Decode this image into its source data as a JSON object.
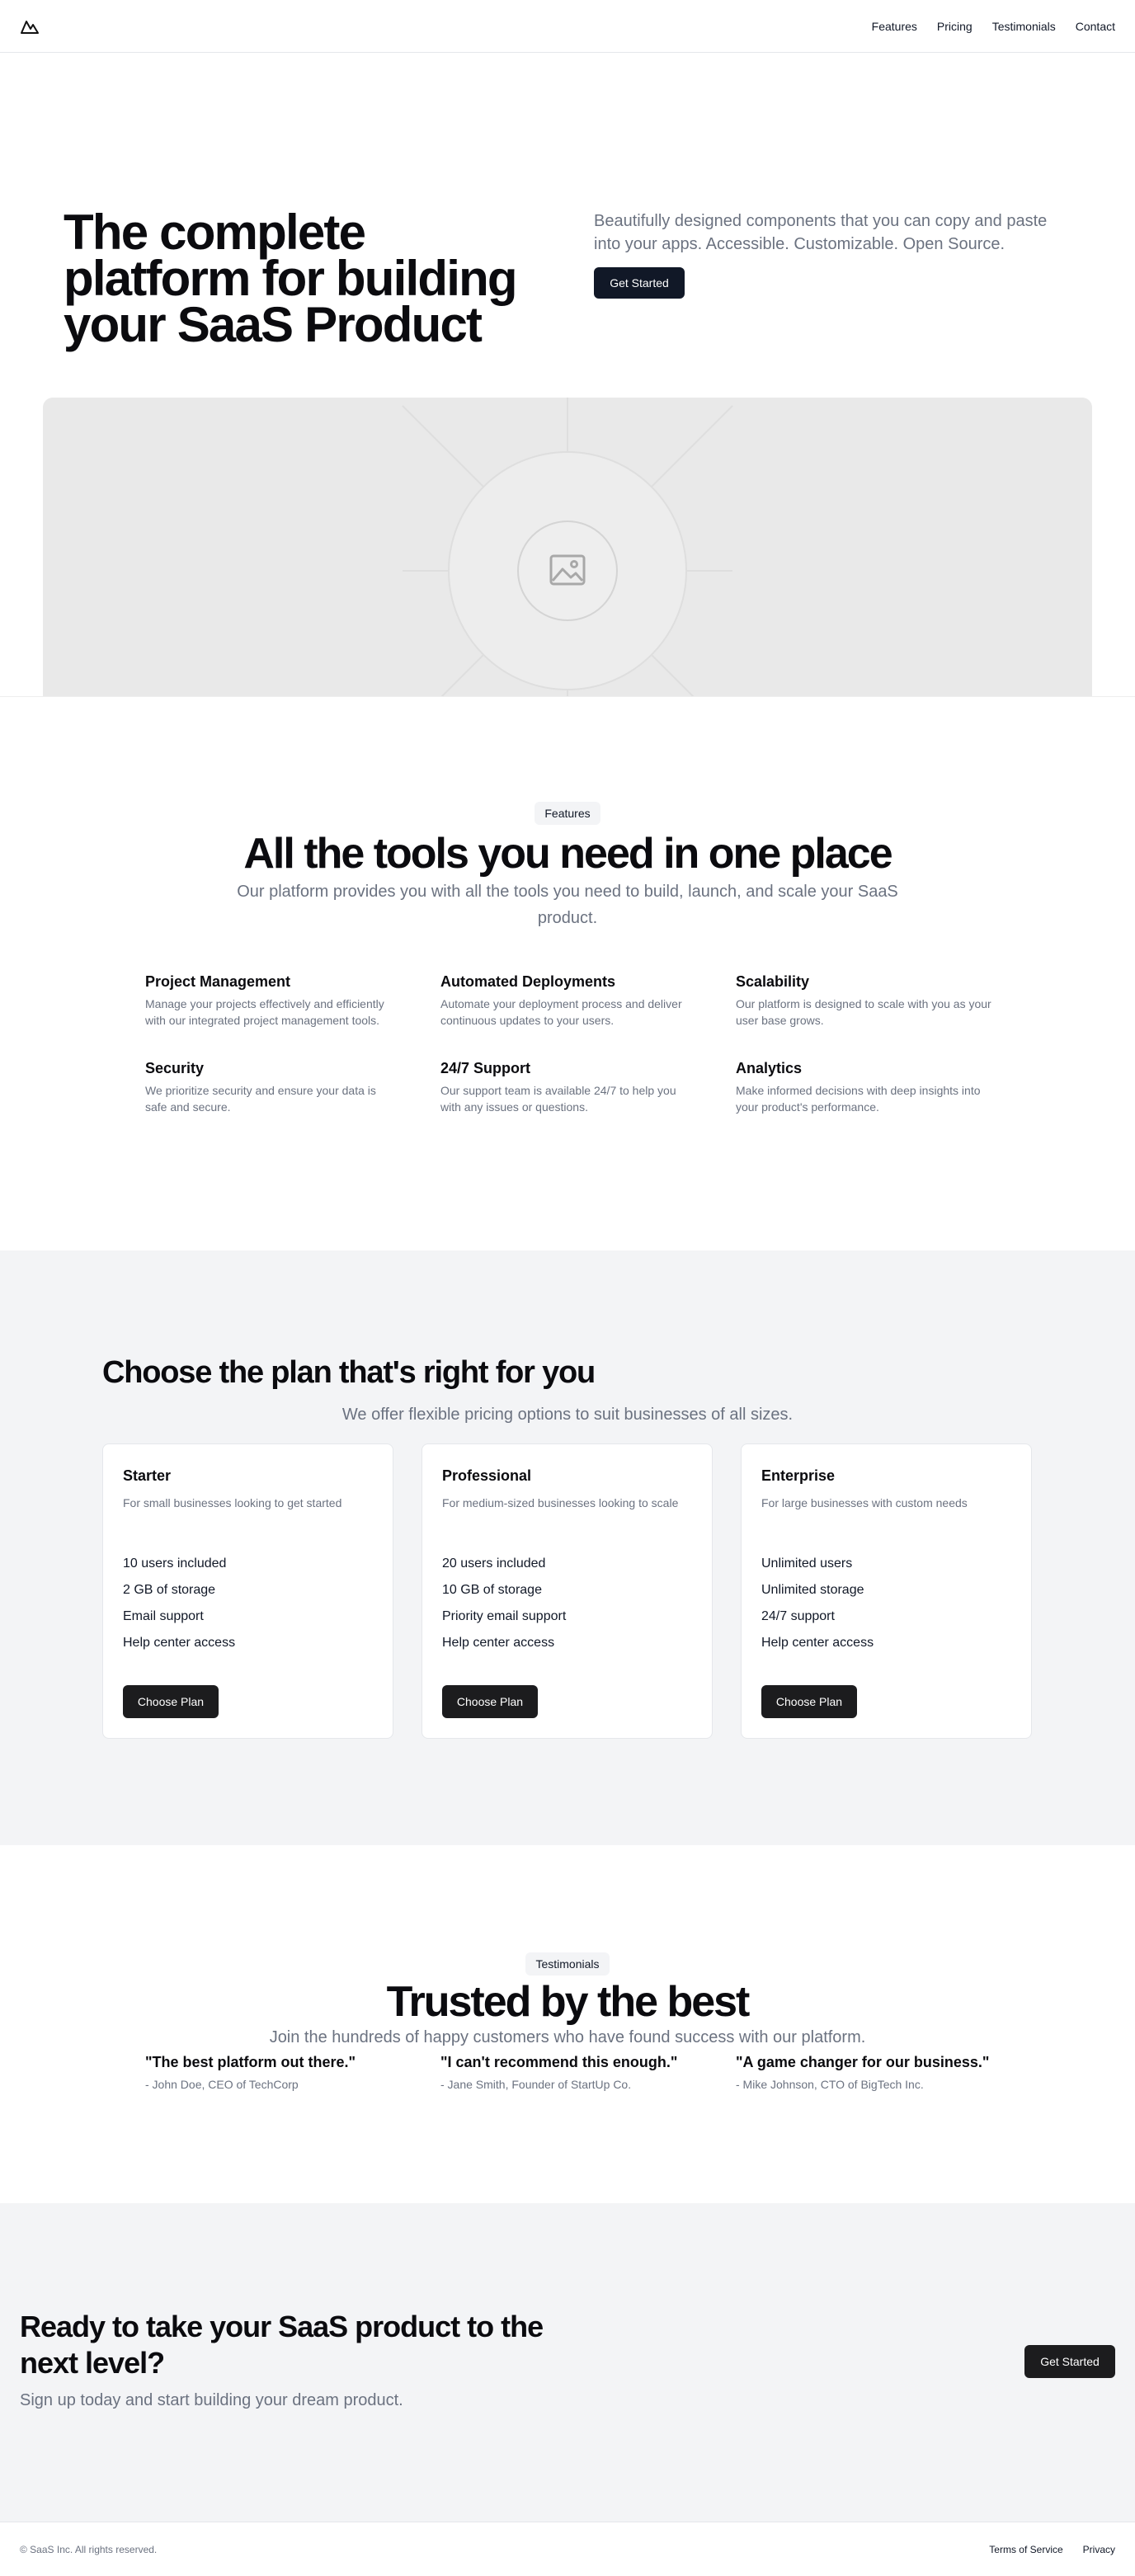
{
  "header": {
    "logo_icon": "mountain-logo-icon",
    "nav": [
      {
        "label": "Features"
      },
      {
        "label": "Pricing"
      },
      {
        "label": "Testimonials"
      },
      {
        "label": "Contact"
      }
    ]
  },
  "hero": {
    "title": "The complete platform for building your SaaS Product",
    "subtitle": "Beautifully designed components that you can copy and paste into your apps. Accessible. Customizable. Open Source.",
    "cta_label": "Get Started",
    "image_icon": "image-placeholder-icon"
  },
  "features": {
    "badge": "Features",
    "title": "All the tools you need in one place",
    "subtitle": "Our platform provides you with all the tools you need to build, launch, and scale your SaaS product.",
    "items": [
      {
        "title": "Project Management",
        "description": "Manage your projects effectively and efficiently with our integrated project management tools."
      },
      {
        "title": "Automated Deployments",
        "description": "Automate your deployment process and deliver continuous updates to your users."
      },
      {
        "title": "Scalability",
        "description": "Our platform is designed to scale with you as your user base grows."
      },
      {
        "title": "Security",
        "description": "We prioritize security and ensure your data is safe and secure."
      },
      {
        "title": "24/7 Support",
        "description": "Our support team is available 24/7 to help you with any issues or questions."
      },
      {
        "title": "Analytics",
        "description": "Make informed decisions with deep insights into your product's performance."
      }
    ]
  },
  "pricing": {
    "title": "Choose the plan that's right for you",
    "subtitle": "We offer flexible pricing options to suit businesses of all sizes.",
    "plans": [
      {
        "name": "Starter",
        "description": "For small businesses looking to get started",
        "features": [
          "10 users included",
          "2 GB of storage",
          "Email support",
          "Help center access"
        ],
        "cta": "Choose Plan"
      },
      {
        "name": "Professional",
        "description": "For medium-sized businesses looking to scale",
        "features": [
          "20 users included",
          "10 GB of storage",
          "Priority email support",
          "Help center access"
        ],
        "cta": "Choose Plan"
      },
      {
        "name": "Enterprise",
        "description": "For large businesses with custom needs",
        "features": [
          "Unlimited users",
          "Unlimited storage",
          "24/7 support",
          "Help center access"
        ],
        "cta": "Choose Plan"
      }
    ]
  },
  "testimonials": {
    "badge": "Testimonials",
    "title": "Trusted by the best",
    "subtitle": "Join the hundreds of happy customers who have found success with our platform.",
    "items": [
      {
        "quote": "\"The best platform out there.\"",
        "author": "- John Doe, CEO of TechCorp"
      },
      {
        "quote": "\"I can't recommend this enough.\"",
        "author": "- Jane Smith, Founder of StartUp Co."
      },
      {
        "quote": "\"A game changer for our business.\"",
        "author": "- Mike Johnson, CTO of BigTech Inc."
      }
    ]
  },
  "cta": {
    "title": "Ready to take your SaaS product to the next level?",
    "subtitle": "Sign up today and start building your dream product.",
    "button": "Get Started"
  },
  "footer": {
    "copyright": "© SaaS Inc. All rights reserved.",
    "links": [
      {
        "label": "Terms of Service"
      },
      {
        "label": "Privacy"
      }
    ]
  },
  "colors": {
    "primary_button": "#111827",
    "muted_text": "#6b7280",
    "section_bg": "#f3f4f6"
  }
}
